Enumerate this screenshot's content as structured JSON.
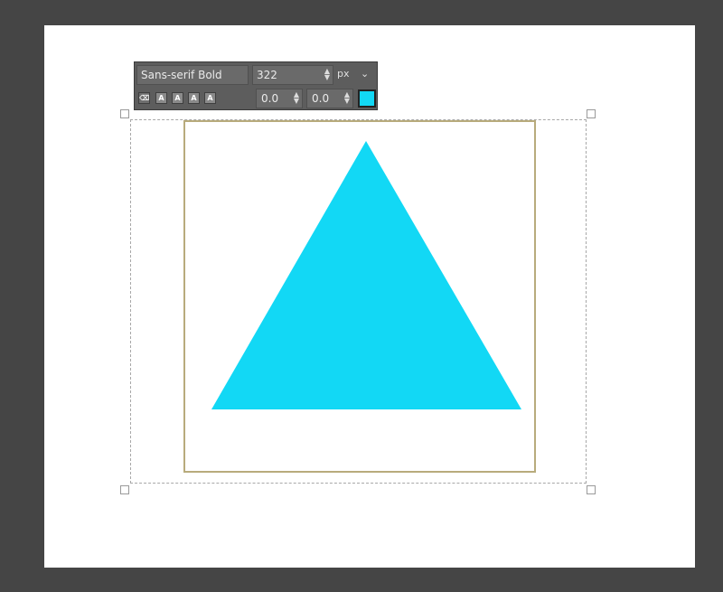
{
  "text_toolbar": {
    "font_name": "Sans-serif Bold",
    "font_size": "322",
    "unit": "px",
    "unit_chevron": "⌄",
    "baseline_offset": "0.0",
    "kerning": "0.0",
    "text_color": "#12d8f5",
    "style_buttons": [
      {
        "name": "clear-style-button",
        "glyph": "⌫"
      },
      {
        "name": "bold-button",
        "glyph": "A"
      },
      {
        "name": "italic-button",
        "glyph": "A"
      },
      {
        "name": "underline-button",
        "glyph": "A"
      },
      {
        "name": "strikethrough-button",
        "glyph": "A"
      }
    ]
  },
  "canvas": {
    "background": "#ffffff",
    "shape": "triangle",
    "shape_color": "#12d8f5",
    "layer_border_color": "#b8ab7c"
  }
}
